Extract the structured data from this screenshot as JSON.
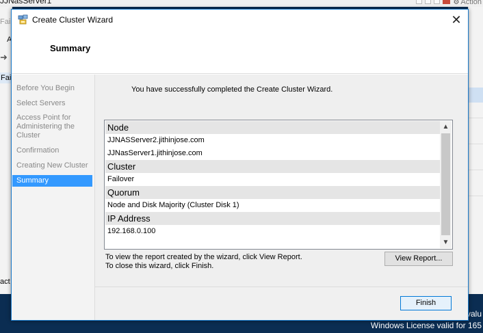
{
  "background": {
    "top_title": "JJNasServer1",
    "top_right_action": "Action",
    "left_labels": [
      "Fail",
      "A",
      "Fail",
      "act"
    ],
    "desktop_text_1": "valu",
    "desktop_text_2": "Windows License valid for 165"
  },
  "wizard": {
    "title": "Create Cluster Wizard",
    "close_glyph": "✕",
    "page_title": "Summary",
    "nav_items": [
      {
        "label": "Before You Begin"
      },
      {
        "label": "Select Servers"
      },
      {
        "label": "Access Point for Administering the Cluster"
      },
      {
        "label": "Confirmation"
      },
      {
        "label": "Creating New Cluster"
      },
      {
        "label": "Summary"
      }
    ],
    "active_step": "Summary",
    "success_message": "You have successfully completed the Create Cluster Wizard.",
    "summary_sections": [
      {
        "header": "Node",
        "values": [
          "JJNASServer2.jithinjose.com",
          "JJNasServer1.jithinjose.com"
        ]
      },
      {
        "header": "Cluster",
        "values": [
          "Failover"
        ]
      },
      {
        "header": "Quorum",
        "values": [
          "Node and Disk Majority (Cluster Disk 1)"
        ]
      },
      {
        "header": "IP Address",
        "values": [
          "192.168.0.100"
        ]
      }
    ],
    "report_note_1": "To view the report created by the wizard, click View Report.",
    "report_note_2": "To close this wizard, click Finish.",
    "view_report_label": "View Report...",
    "finish_label": "Finish"
  },
  "icons": {
    "wizard_icon": "cluster-wizard-icon",
    "close": "close-icon",
    "scroll_up": "chevron-up-icon",
    "scroll_down": "chevron-down-icon"
  },
  "colors": {
    "accent": "#3399ff",
    "window_border": "#1979ca",
    "desktop": "#0b2d52"
  }
}
